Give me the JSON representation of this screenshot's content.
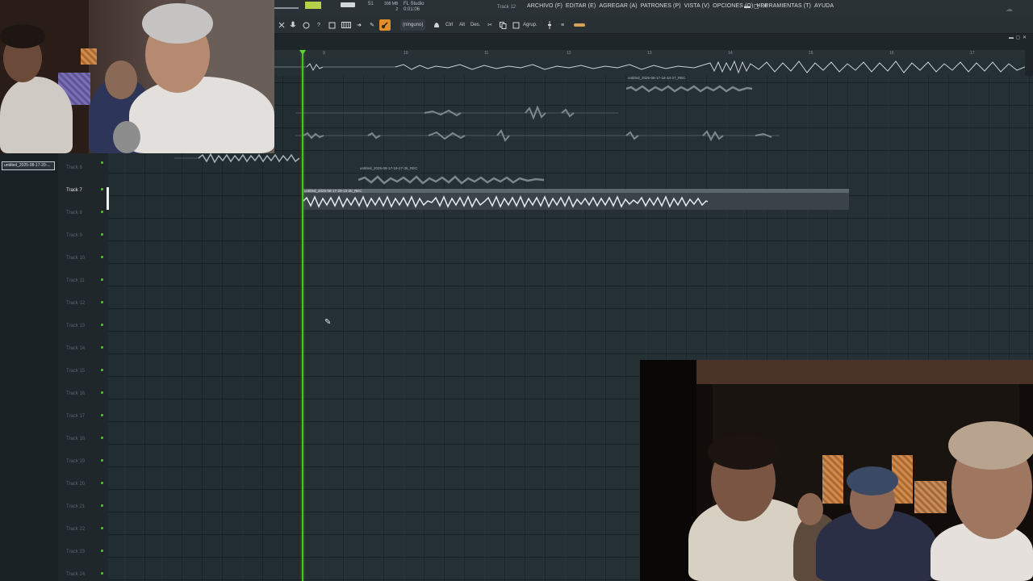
{
  "menu": {
    "items": [
      "ARCHIVO (F)",
      "EDITAR (E)",
      "AGREGAR (A)",
      "PATRONES (P)",
      "VISTA (V)",
      "OPCIONES (O)",
      "HERRAMIENTAS (T)",
      "AYUDA"
    ]
  },
  "window_controls": {
    "minimize": "▬",
    "maximize": "◻",
    "close": "✕"
  },
  "header": {
    "hint": "Track 12",
    "app_title": "FL Studio",
    "app_time": "0:01:06",
    "memory": "308 MB",
    "memory_sub": "2",
    "cpu": "51"
  },
  "toolbar": {
    "snap_label": "(ninguno)",
    "ctrl_label": "Ctrl",
    "alt_label": "Alt",
    "des_label": "Des.",
    "agrupar_label": "Agrup."
  },
  "ruler": {
    "marks": [
      "",
      "9",
      "10",
      "11",
      "12",
      "13",
      "14",
      "15",
      "16",
      "17"
    ]
  },
  "selected_clip_name": "untitled_2025-08-17-20-...",
  "tracks": [
    {
      "name": "Track 6",
      "highlight": false
    },
    {
      "name": "Track 7",
      "highlight": true
    },
    {
      "name": "Track 8",
      "highlight": false
    },
    {
      "name": "Track 9",
      "highlight": false
    },
    {
      "name": "Track 10",
      "highlight": false
    },
    {
      "name": "Track 11",
      "highlight": false
    },
    {
      "name": "Track 12",
      "highlight": false
    },
    {
      "name": "Track 13",
      "highlight": false
    },
    {
      "name": "Track 14",
      "highlight": false
    },
    {
      "name": "Track 15",
      "highlight": false
    },
    {
      "name": "Track 16",
      "highlight": false
    },
    {
      "name": "Track 17",
      "highlight": false
    },
    {
      "name": "Track 18",
      "highlight": false
    },
    {
      "name": "Track 19",
      "highlight": false
    },
    {
      "name": "Track 20",
      "highlight": false
    },
    {
      "name": "Track 21",
      "highlight": false
    },
    {
      "name": "Track 22",
      "highlight": false
    },
    {
      "name": "Track 23",
      "highlight": false
    },
    {
      "name": "Track 24",
      "highlight": false
    }
  ],
  "clips": {
    "upper_right": "untitled_2025-08-17-18-34-27_REC",
    "track6_mid": "untitled_2025-08-17-19-27-36_REC",
    "main": "untitled_2025-08-17-20-13-20_REC"
  },
  "colors": {
    "playhead": "#44c51f",
    "accent": "#e18d2a",
    "led": "#48c22a"
  }
}
